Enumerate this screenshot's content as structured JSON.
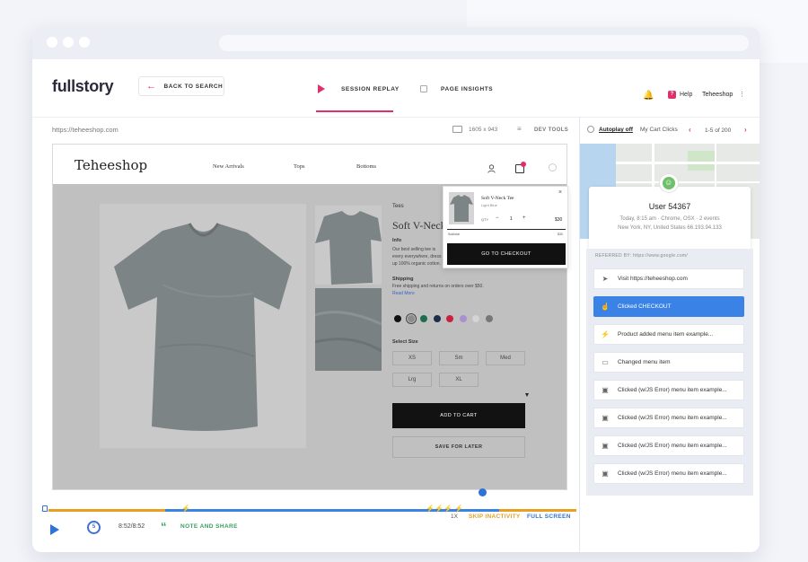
{
  "app": {
    "logo": "fullstory",
    "back_label": "BACK TO SEARCH",
    "tabs": [
      {
        "label": "SESSION REPLAY",
        "active": true
      },
      {
        "label": "PAGE INSIGHTS",
        "active": false
      }
    ],
    "help_label": "Help",
    "account": "Teheeshop",
    "accent": "#e0306a"
  },
  "replay": {
    "url": "https://teheeshop.com",
    "dimensions": "1605 x 943",
    "devtools": "DEV TOOLS"
  },
  "shop": {
    "logo": "Teheeshop",
    "nav": [
      "New Arrivals",
      "Tops",
      "Bottoms"
    ],
    "category": "Tees",
    "product_title": "Soft V-Neck Te",
    "info_heading": "Info",
    "info_text": "Our best selling tee is every everywhere, dress it up 100% organic cotton.",
    "shipping_heading": "Shipping",
    "shipping_text": "Free shipping and returns on orders over $50.",
    "read_more": "Read More",
    "swatches": [
      "#111111",
      "#8c8c8c",
      "#1f6b4e",
      "#1d2d4c",
      "#c9203d",
      "#a890cf",
      "#d4d4d4",
      "#777777"
    ],
    "select_size": "Select Size",
    "sizes": [
      "XS",
      "Sm",
      "Med",
      "Lrg",
      "XL"
    ],
    "add_to_cart": "ADD TO CART",
    "save_later": "SAVE FOR LATER",
    "mini_cart": {
      "name": "Soft V-Neck Tee",
      "color": "Light Blue",
      "qty_label": "QTY",
      "minus": "−",
      "qty": "1",
      "plus": "+",
      "price": "$30",
      "subtotal_label": "Subtotal",
      "subtotal": "$30",
      "checkout": "GO TO CHECKOUT",
      "close": "×"
    }
  },
  "player": {
    "time": "8:52/8:52",
    "note_share": "NOTE AND SHARE",
    "speed": "1X",
    "skip_inactivity": "SKIP INACTIVITY",
    "full_screen": "FULL SCREEN",
    "restart_glyph": "5"
  },
  "panel": {
    "autoplay": "Autoplay off",
    "segment": "My Cart Clicks",
    "count": "1-5 of 200",
    "user_name": "User  54367",
    "meta_line1": "Today, 8:15 am · Chrome, OSX · 2 events",
    "meta_line2": "New York, NY, United States  66.193.94.133",
    "referred_by": "REFERRED BY:  https://www.google.com/",
    "events": [
      {
        "label": "Visit https://teheeshop.com",
        "icon": "send-icon",
        "glyph": "➤",
        "active": false
      },
      {
        "label": "Clicked CHECKOUT",
        "icon": "pointer-hand-icon",
        "glyph": "☝",
        "active": true
      },
      {
        "label": "Product added menu item example...",
        "icon": "bolt-icon",
        "glyph": "⚡",
        "active": false
      },
      {
        "label": "Changed menu item",
        "icon": "field-icon",
        "glyph": "▭",
        "active": false
      },
      {
        "label": "Clicked (w/JS Error) menu item example...",
        "icon": "window-error-icon",
        "glyph": "▣",
        "active": false
      },
      {
        "label": "Clicked (w/JS Error) menu item example...",
        "icon": "window-error-icon",
        "glyph": "▣",
        "active": false
      },
      {
        "label": "Clicked (w/JS Error) menu item example...",
        "icon": "window-error-icon",
        "glyph": "▣",
        "active": false
      },
      {
        "label": "Clicked (w/JS Error) menu item example...",
        "icon": "window-error-icon",
        "glyph": "▣",
        "active": false
      }
    ]
  }
}
